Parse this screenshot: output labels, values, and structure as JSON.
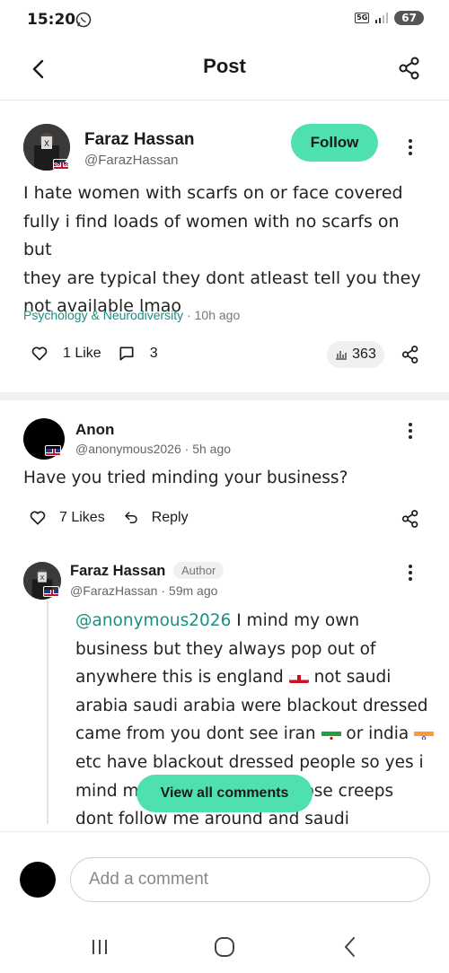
{
  "status_bar": {
    "time": "15:20",
    "network": "5G",
    "battery": "67"
  },
  "header": {
    "title": "Post"
  },
  "post": {
    "author": "Faraz Hassan",
    "handle": "@FarazHassan",
    "follow_label": "Follow",
    "lines": [
      "I hate women with scarfs on or face covered",
      "fully i find loads of women with no scarfs on but",
      "they are typical they dont atleast tell you they",
      "not available lmao"
    ],
    "category": "Psychology & Neurodiversity",
    "time": " · 10h ago",
    "likes": "1 Like",
    "comments": "3",
    "views": "363"
  },
  "comment": {
    "author": "Anon",
    "handle": "@anonymous2026",
    "time": " · 5h ago",
    "text": "Have you tried minding your business?",
    "likes": "7 Likes",
    "reply_label": "Reply"
  },
  "reply": {
    "author": "Faraz Hassan",
    "tag": "Author",
    "handle": "@FarazHassan",
    "time": " · 59m ago",
    "mention": "@anonymous2026",
    "segments": [
      " I mind my own business but they always pop out of anywhere this is england ",
      " not saudi arabia saudi arabia were blackout dressed came from you dont see iran ",
      " or india ",
      " etc have blackout dressed people so yes i mind my own business if those creeps dont follow me around and saudi"
    ]
  },
  "view_all_label": "View all comments",
  "compose": {
    "placeholder": "Add a comment"
  }
}
